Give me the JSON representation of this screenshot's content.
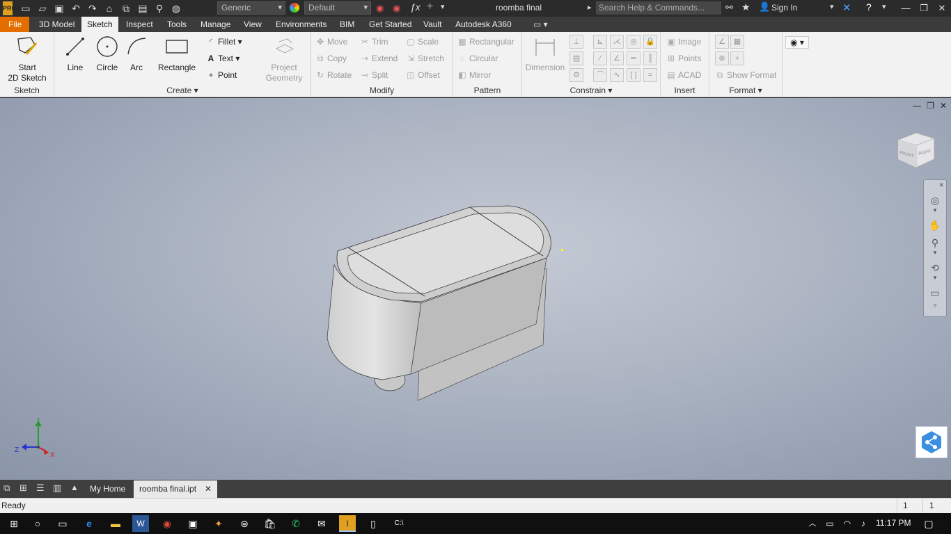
{
  "titlebar": {
    "app_logo": "PRO",
    "material_dropdown": "Generic",
    "appearance_dropdown": "Default",
    "document_title": "roomba final",
    "search_placeholder": "Search Help & Commands...",
    "signin_label": "Sign In"
  },
  "tabs": [
    "File",
    "3D Model",
    "Sketch",
    "Inspect",
    "Tools",
    "Manage",
    "View",
    "Environments",
    "BIM",
    "Get Started",
    "Vault",
    "Autodesk A360"
  ],
  "active_tab": "Sketch",
  "ribbon": {
    "sketch": {
      "title": "Sketch",
      "start_label_1": "Start",
      "start_label_2": "2D Sketch"
    },
    "create": {
      "title": "Create",
      "line": "Line",
      "circle": "Circle",
      "arc": "Arc",
      "rectangle": "Rectangle",
      "fillet": "Fillet",
      "text": "Text",
      "point": "Point",
      "project_1": "Project",
      "project_2": "Geometry"
    },
    "modify": {
      "title": "Modify",
      "move": "Move",
      "trim": "Trim",
      "scale": "Scale",
      "copy": "Copy",
      "extend": "Extend",
      "stretch": "Stretch",
      "rotate": "Rotate",
      "split": "Split",
      "offset": "Offset"
    },
    "pattern": {
      "title": "Pattern",
      "rectangular": "Rectangular",
      "circular": "Circular",
      "mirror": "Mirror"
    },
    "constrain": {
      "title": "Constrain",
      "dimension": "Dimension"
    },
    "insert": {
      "title": "Insert",
      "image": "Image",
      "points": "Points",
      "acad": "ACAD"
    },
    "format": {
      "title": "Format",
      "show_format": "Show Format"
    }
  },
  "viewcube": {
    "front": "FRONT",
    "right": "RIGHT"
  },
  "triad": {
    "x": "X",
    "y": "Y",
    "z": "Z"
  },
  "doc_tabs": {
    "home": "My Home",
    "file": "roomba final.ipt"
  },
  "status": {
    "text": "Ready",
    "count1": "1",
    "count2": "1"
  },
  "taskbar": {
    "clock": "11:17 PM"
  },
  "colors": {
    "file_tab": "#e46d00",
    "ribbon_bg": "#f2f2f2",
    "titlebar_bg": "#2b2b2b"
  }
}
